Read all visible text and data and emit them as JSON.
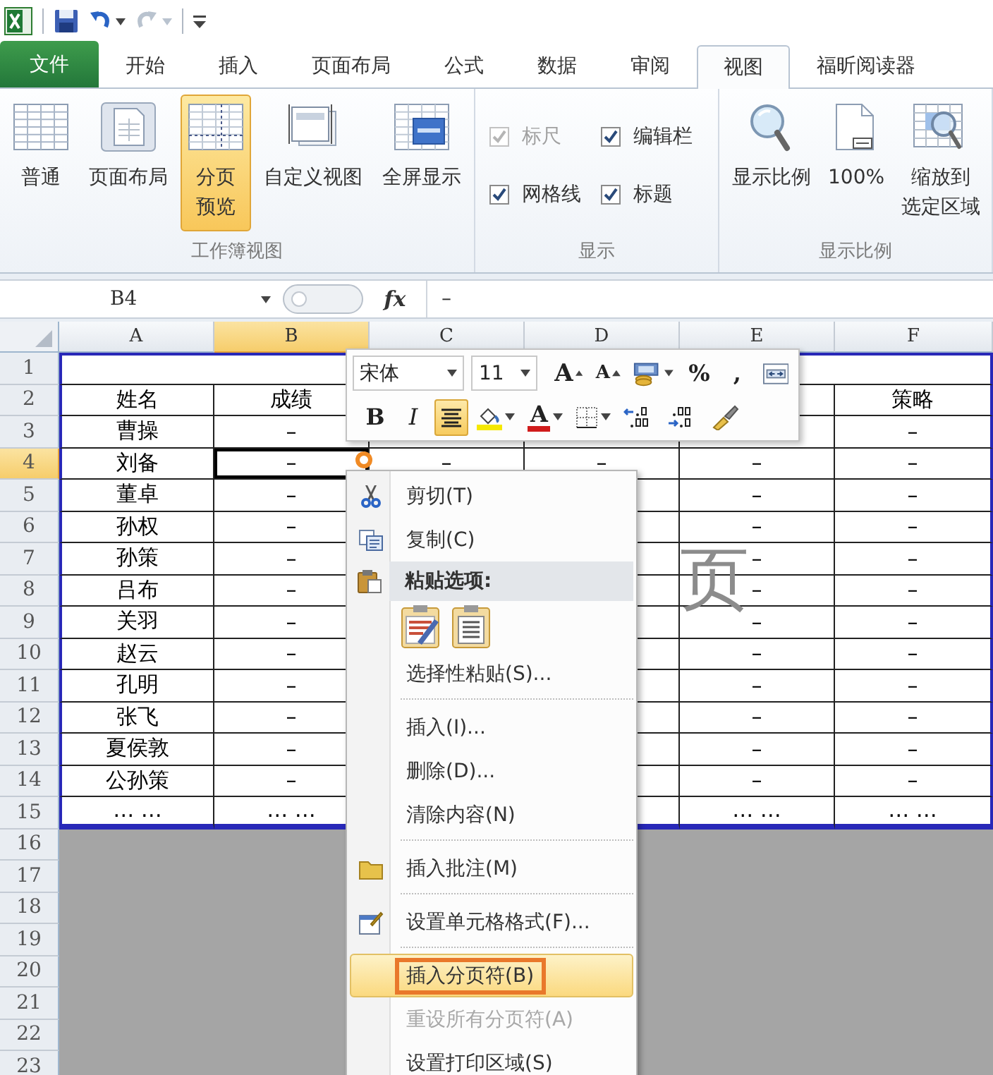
{
  "quick_access": [
    {
      "kind": "app"
    },
    {
      "kind": "save"
    },
    {
      "kind": "undo",
      "disabled": false
    },
    {
      "kind": "redo",
      "disabled": true
    },
    {
      "kind": "customize"
    }
  ],
  "tabs": [
    {
      "label": "文件",
      "kind": "file",
      "selected": false
    },
    {
      "label": "开始",
      "kind": "tab",
      "selected": false
    },
    {
      "label": "插入",
      "kind": "tab",
      "selected": false
    },
    {
      "label": "页面布局",
      "kind": "tab",
      "selected": false
    },
    {
      "label": "公式",
      "kind": "tab",
      "selected": false
    },
    {
      "label": "数据",
      "kind": "tab",
      "selected": false
    },
    {
      "label": "审阅",
      "kind": "tab",
      "selected": false
    },
    {
      "label": "视图",
      "kind": "tab",
      "selected": true
    },
    {
      "label": "福昕阅读器",
      "kind": "tab",
      "selected": false
    }
  ],
  "ribbon": {
    "groups": [
      {
        "kind": "views",
        "title": "工作簿视图",
        "buttons": [
          {
            "lines": [
              "普通"
            ],
            "selected": false
          },
          {
            "lines": [
              "页面布局"
            ],
            "selected": false
          },
          {
            "lines": [
              "分页",
              "预览"
            ],
            "selected": true
          },
          {
            "lines": [
              "自定义视图"
            ],
            "selected": false
          },
          {
            "lines": [
              "全屏显示"
            ],
            "selected": false
          }
        ]
      },
      {
        "kind": "checks",
        "title": "显示",
        "checkboxes": [
          {
            "label": "标尺",
            "checked": true,
            "disabled": true
          },
          {
            "label": "编辑栏",
            "checked": true,
            "disabled": false
          },
          {
            "label": "网格线",
            "checked": true,
            "disabled": false
          },
          {
            "label": "标题",
            "checked": true,
            "disabled": false
          }
        ]
      },
      {
        "kind": "zoom",
        "title": "显示比例",
        "buttons": [
          {
            "lines": [
              "显示比例"
            ]
          },
          {
            "lines": [
              "100%"
            ]
          },
          {
            "lines": [
              "缩放到",
              "选定区域"
            ]
          }
        ]
      }
    ]
  },
  "formula_bar": {
    "name_box": "B4",
    "fx": "fx",
    "value": "–"
  },
  "sheet": {
    "columns": [
      {
        "label": "A",
        "selected": false
      },
      {
        "label": "B",
        "selected": true
      },
      {
        "label": "C",
        "selected": false
      },
      {
        "label": "D",
        "selected": false
      },
      {
        "label": "E",
        "selected": false
      },
      {
        "label": "F",
        "selected": false
      }
    ],
    "rows": [
      {
        "label": "1",
        "selected": false,
        "in_print_area": true,
        "merged": true,
        "cells": []
      },
      {
        "label": "2",
        "selected": false,
        "in_print_area": true,
        "cells": [
          "姓名",
          "成绩",
          null,
          null,
          null,
          "策略"
        ]
      },
      {
        "label": "3",
        "selected": false,
        "in_print_area": true,
        "cells": [
          "曹操",
          "–",
          null,
          null,
          null,
          "–"
        ]
      },
      {
        "label": "4",
        "selected": true,
        "in_print_area": true,
        "cells": [
          "刘备",
          "–",
          "–",
          "–",
          "–",
          "–"
        ]
      },
      {
        "label": "5",
        "selected": false,
        "in_print_area": true,
        "cells": [
          "董卓",
          "–",
          null,
          null,
          "–",
          "–"
        ]
      },
      {
        "label": "6",
        "selected": false,
        "in_print_area": true,
        "cells": [
          "孙权",
          "–",
          null,
          null,
          "–",
          "–"
        ]
      },
      {
        "label": "7",
        "selected": false,
        "in_print_area": true,
        "cells": [
          "孙策",
          "–",
          null,
          null,
          "–",
          "–"
        ]
      },
      {
        "label": "8",
        "selected": false,
        "in_print_area": true,
        "cells": [
          "吕布",
          "–",
          null,
          null,
          "–",
          "–"
        ]
      },
      {
        "label": "9",
        "selected": false,
        "in_print_area": true,
        "cells": [
          "关羽",
          "–",
          null,
          null,
          "–",
          "–"
        ]
      },
      {
        "label": "10",
        "selected": false,
        "in_print_area": true,
        "cells": [
          "赵云",
          "–",
          null,
          null,
          "–",
          "–"
        ]
      },
      {
        "label": "11",
        "selected": false,
        "in_print_area": true,
        "cells": [
          "孔明",
          "–",
          null,
          null,
          "–",
          "–"
        ]
      },
      {
        "label": "12",
        "selected": false,
        "in_print_area": true,
        "cells": [
          "张飞",
          "–",
          null,
          null,
          "–",
          "–"
        ]
      },
      {
        "label": "13",
        "selected": false,
        "in_print_area": true,
        "cells": [
          "夏侯敦",
          "–",
          null,
          null,
          "–",
          "–"
        ]
      },
      {
        "label": "14",
        "selected": false,
        "in_print_area": true,
        "cells": [
          "公孙策",
          "–",
          null,
          null,
          "–",
          "–"
        ]
      },
      {
        "label": "15",
        "selected": false,
        "in_print_area": true,
        "cells": [
          "… …",
          "… …",
          null,
          null,
          "… …",
          "… …"
        ]
      },
      {
        "label": "16",
        "selected": false,
        "in_print_area": false
      },
      {
        "label": "17",
        "selected": false,
        "in_print_area": false
      },
      {
        "label": "18",
        "selected": false,
        "in_print_area": false
      },
      {
        "label": "19",
        "selected": false,
        "in_print_area": false
      },
      {
        "label": "20",
        "selected": false,
        "in_print_area": false
      },
      {
        "label": "21",
        "selected": false,
        "in_print_area": false
      },
      {
        "label": "22",
        "selected": false,
        "in_print_area": false
      },
      {
        "label": "23",
        "selected": false,
        "in_print_area": false
      }
    ],
    "page_label": "页"
  },
  "mini_toolbar": {
    "font": "宋体",
    "size": "11",
    "rows": [
      [
        {
          "kind": "grow-font",
          "label": "A",
          "pressed": false
        },
        {
          "kind": "shrink-font",
          "label": "A",
          "pressed": false
        },
        {
          "kind": "accounting",
          "dropdown": true,
          "pressed": false
        },
        {
          "kind": "percent",
          "label": "%",
          "pressed": false
        },
        {
          "kind": "comma",
          "label": ",",
          "pressed": false
        },
        {
          "kind": "merge",
          "pressed": false
        }
      ],
      [
        {
          "kind": "bold",
          "label": "B",
          "pressed": false
        },
        {
          "kind": "italic",
          "label": "I",
          "pressed": false
        },
        {
          "kind": "align-center",
          "pressed": true
        },
        {
          "kind": "fill-color",
          "dropdown": true,
          "pressed": false
        },
        {
          "kind": "font-color",
          "label": "A",
          "dropdown": true,
          "pressed": false
        },
        {
          "kind": "borders",
          "dropdown": true,
          "pressed": false
        },
        {
          "kind": "increase-decimal",
          "pressed": false
        },
        {
          "kind": "decrease-decimal",
          "pressed": false
        },
        {
          "kind": "format-painter",
          "pressed": false
        }
      ]
    ]
  },
  "context_menu": {
    "items": [
      {
        "kind": "item",
        "label": "剪切(T)",
        "selected": false,
        "disabled": false
      },
      {
        "kind": "item",
        "label": "复制(C)",
        "selected": false,
        "disabled": false
      },
      {
        "kind": "header",
        "label": "粘贴选项:"
      },
      {
        "kind": "paste-options"
      },
      {
        "kind": "item",
        "label": "选择性粘贴(S)...",
        "selected": false,
        "disabled": false
      },
      {
        "kind": "item",
        "label": "插入(I)...",
        "divider": true,
        "selected": false,
        "disabled": false
      },
      {
        "kind": "item",
        "label": "删除(D)...",
        "selected": false,
        "disabled": false
      },
      {
        "kind": "item",
        "label": "清除内容(N)",
        "selected": false,
        "disabled": false
      },
      {
        "kind": "item",
        "label": "插入批注(M)",
        "divider": true,
        "selected": false,
        "disabled": false
      },
      {
        "kind": "item",
        "label": "设置单元格格式(F)...",
        "divider": true,
        "selected": false,
        "disabled": false
      },
      {
        "kind": "item",
        "label": "插入分页符(B)",
        "divider": true,
        "annotated": true,
        "selected": true,
        "disabled": false
      },
      {
        "kind": "item",
        "label": "重设所有分页符(A)",
        "selected": false,
        "disabled": true
      },
      {
        "kind": "item",
        "label": "设置打印区域(S)",
        "selected": false,
        "disabled": false
      }
    ]
  }
}
